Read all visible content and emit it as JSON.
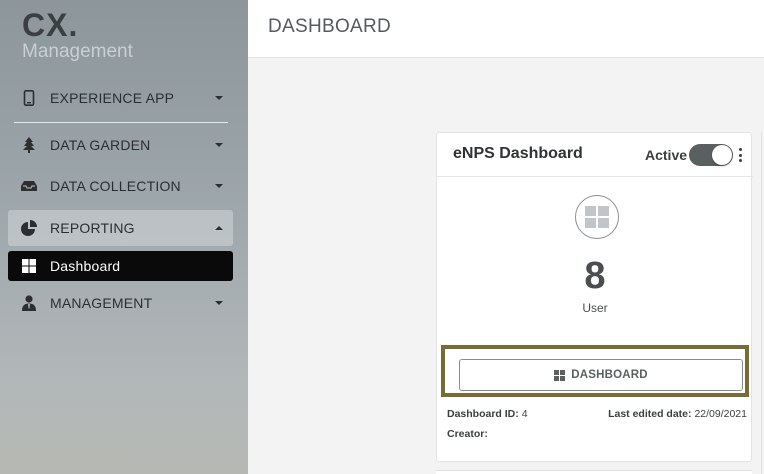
{
  "logo": {
    "main": "CX.",
    "sub": "Management"
  },
  "sidebar": {
    "items": [
      {
        "label": "EXPERIENCE APP",
        "icon": "phone-icon"
      },
      {
        "label": "DATA GARDEN",
        "icon": "tree-icon"
      },
      {
        "label": "DATA COLLECTION",
        "icon": "inbox-icon"
      },
      {
        "label": "REPORTING",
        "icon": "pie-chart-icon",
        "open": true
      },
      {
        "label": "Dashboard",
        "icon": "grid-icon",
        "active": true
      },
      {
        "label": "MANAGEMENT",
        "icon": "user-tie-icon"
      }
    ]
  },
  "header": {
    "title": "DASHBOARD"
  },
  "card": {
    "title": "eNPS Dashboard",
    "status_label": "Active",
    "toggle_on": true,
    "count": "8",
    "count_label": "User",
    "button_label": "DASHBOARD",
    "id_label": "Dashboard ID:",
    "id_value": "4",
    "edited_label": "Last edited date:",
    "edited_value": "22/09/2021",
    "creator_label": "Creator:",
    "creator_value": ""
  },
  "colors": {
    "sidebar_active_bg": "#0a0a0a",
    "highlight_border": "#7a6a33",
    "toggle_bg": "#5a5f62"
  }
}
